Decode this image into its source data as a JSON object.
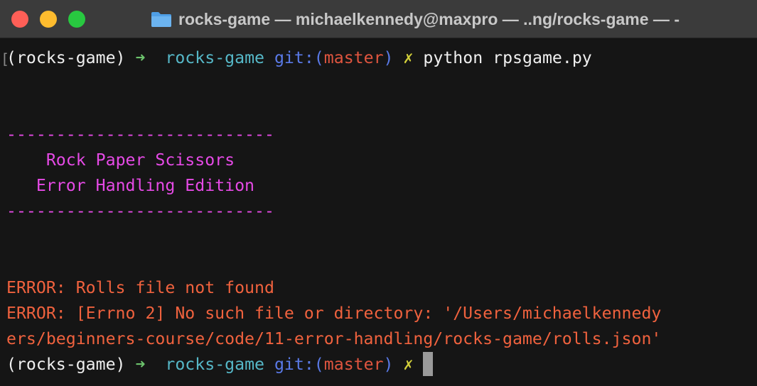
{
  "window": {
    "title": "rocks-game — michaelkennedy@maxpro — ..ng/rocks-game — -",
    "colors": {
      "close": "#ff5f57",
      "minimize": "#febc2e",
      "zoom": "#28c840",
      "folder": "#5aa7e8"
    }
  },
  "terminal": {
    "prompt_env": "(rocks-game)",
    "prompt_arrow": "➜",
    "prompt_dir": "rocks-game",
    "prompt_git": "git:(",
    "prompt_branch": "master",
    "prompt_git_close": ")",
    "prompt_dirty": "✗",
    "command": "python rpsgame.py",
    "separator_top": "---------------------------",
    "banner_title": "Rock Paper Scissors",
    "banner_subtitle": "Error Handling Edition",
    "separator_bottom": "---------------------------",
    "error_1": "ERROR: Rolls file not found",
    "error_2": "ERROR: [Errno 2] No such file or directory: '/Users/michaelkennedy",
    "error_3": "ers/beginners-course/code/11-error-handling/rocks-game/rolls.json'"
  }
}
